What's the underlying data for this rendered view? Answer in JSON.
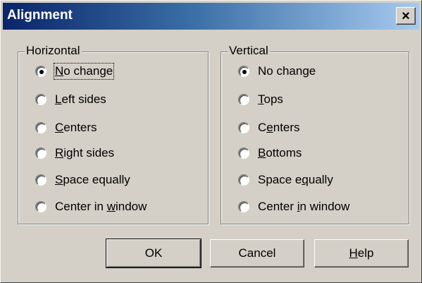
{
  "window": {
    "title": "Alignment",
    "close_glyph": "×"
  },
  "horizontal": {
    "legend": "Horizontal",
    "options": [
      {
        "pre": "",
        "key": "N",
        "post": "o change",
        "checked": true
      },
      {
        "pre": "",
        "key": "L",
        "post": "eft sides",
        "checked": false
      },
      {
        "pre": "",
        "key": "C",
        "post": "enters",
        "checked": false
      },
      {
        "pre": "",
        "key": "R",
        "post": "ight sides",
        "checked": false
      },
      {
        "pre": "",
        "key": "S",
        "post": "pace equally",
        "checked": false
      },
      {
        "pre": "Center in ",
        "key": "w",
        "post": "indow",
        "checked": false
      }
    ]
  },
  "vertical": {
    "legend": "Vertical",
    "options": [
      {
        "pre": "No change",
        "key": "",
        "post": "",
        "checked": true
      },
      {
        "pre": "",
        "key": "T",
        "post": "ops",
        "checked": false
      },
      {
        "pre": "C",
        "key": "e",
        "post": "nters",
        "checked": false
      },
      {
        "pre": "",
        "key": "B",
        "post": "ottoms",
        "checked": false
      },
      {
        "pre": "Space e",
        "key": "q",
        "post": "ually",
        "checked": false
      },
      {
        "pre": "Center ",
        "key": "i",
        "post": "n window",
        "checked": false
      }
    ]
  },
  "buttons": {
    "ok": "OK",
    "cancel": "Cancel",
    "help_key": "H",
    "help_rest": "elp"
  }
}
